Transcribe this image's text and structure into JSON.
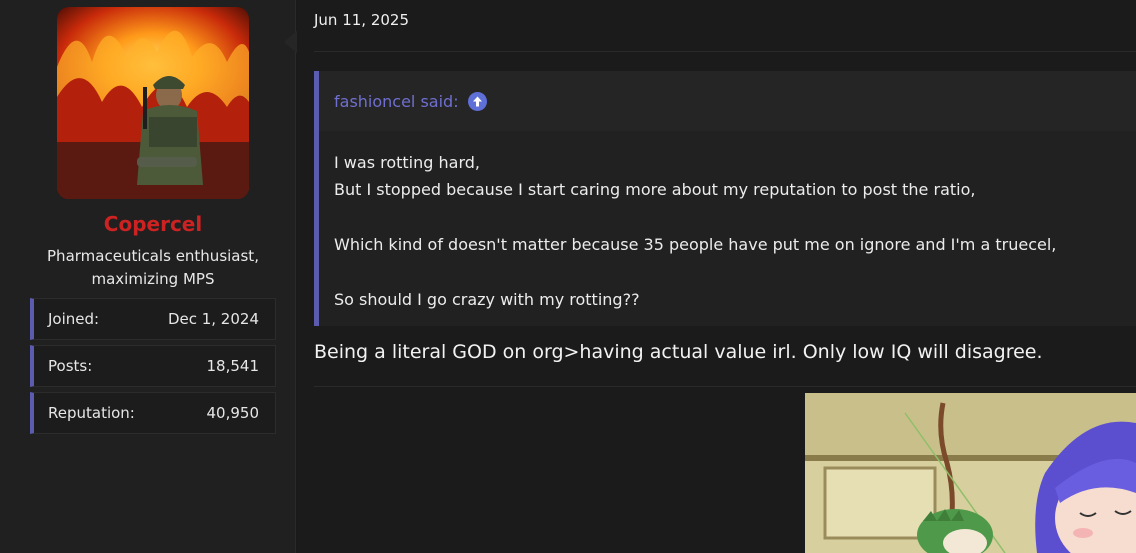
{
  "user": {
    "name": "Copercel",
    "title": "Pharmaceuticals enthusiast, maximizing MPS",
    "stats": [
      {
        "label": "Joined:",
        "value": "Dec 1, 2024"
      },
      {
        "label": "Posts:",
        "value": "18,541"
      },
      {
        "label": "Reputation:",
        "value": "40,950"
      }
    ]
  },
  "post": {
    "date": "Jun 11, 2025",
    "quote": {
      "author": "fashioncel said:",
      "lines": [
        "I was rotting hard,",
        "But I stopped because I start caring more about my reputation to post the ratio,",
        "Which kind of doesn't matter because 35 people have put me on ignore and I'm a truecel,",
        "So should I go crazy with my rotting??"
      ]
    },
    "reply": "Being a literal GOD on org>having actual value irl. Only low IQ will disagree."
  },
  "colors": {
    "accent": "#5b5bb0",
    "username": "#cc2222",
    "quote_author": "#6f6fd0"
  }
}
